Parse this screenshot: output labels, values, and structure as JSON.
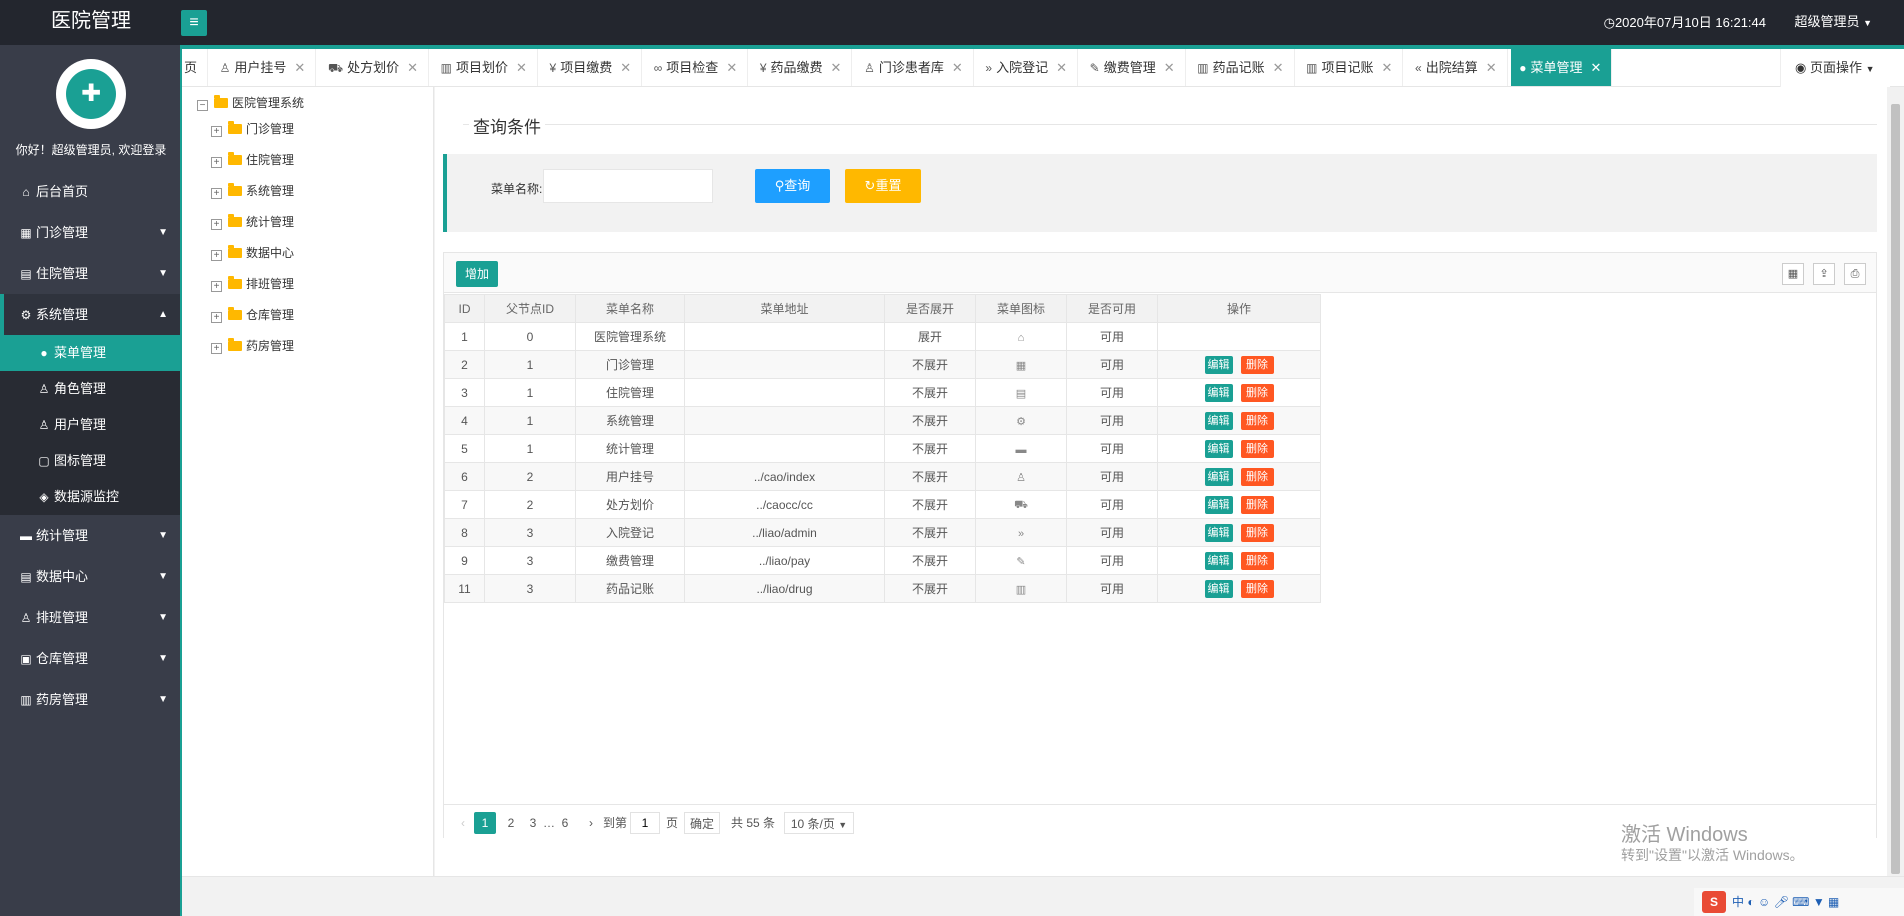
{
  "header": {
    "app_title": "医院管理",
    "menu_icon": "hamburger-icon",
    "datetime": "2020年07月10日 16:21:44",
    "user": "超级管理员"
  },
  "sidebar": {
    "welcome": "你好！超级管理员, 欢迎登录",
    "items": [
      {
        "label": "后台首页",
        "icon": "home-icon"
      },
      {
        "label": "门诊管理",
        "icon": "grid-plus-icon"
      },
      {
        "label": "住院管理",
        "icon": "building-icon"
      },
      {
        "label": "系统管理",
        "icon": "gear-icon"
      },
      {
        "label": "统计管理",
        "icon": "chat-icon"
      },
      {
        "label": "数据中心",
        "icon": "document-icon"
      },
      {
        "label": "排班管理",
        "icon": "users-icon"
      },
      {
        "label": "仓库管理",
        "icon": "boxes-icon"
      },
      {
        "label": "药房管理",
        "icon": "book-icon"
      }
    ],
    "sub_items": [
      {
        "label": "菜单管理",
        "icon": "circle-icon"
      },
      {
        "label": "角色管理",
        "icon": "user-icon"
      },
      {
        "label": "用户管理",
        "icon": "users-icon"
      },
      {
        "label": "图标管理",
        "icon": "note-icon"
      },
      {
        "label": "数据源监控",
        "icon": "cube-icon"
      }
    ]
  },
  "tabs": [
    {
      "label": "页",
      "icon": ""
    },
    {
      "label": "用户挂号",
      "icon": "user-icon"
    },
    {
      "label": "处方划价",
      "icon": "cart-icon"
    },
    {
      "label": "项目划价",
      "icon": "chart-icon"
    },
    {
      "label": "项目缴费",
      "icon": "yen-icon"
    },
    {
      "label": "项目检查",
      "icon": "link-icon"
    },
    {
      "label": "药品缴费",
      "icon": "yen-icon"
    },
    {
      "label": "门诊患者库",
      "icon": "user-icon"
    },
    {
      "label": "入院登记",
      "icon": "double-right-icon"
    },
    {
      "label": "缴费管理",
      "icon": "edit-icon"
    },
    {
      "label": "药品记账",
      "icon": "book-icon"
    },
    {
      "label": "项目记账",
      "icon": "book-icon"
    },
    {
      "label": "出院结算",
      "icon": "double-left-icon"
    },
    {
      "label": "菜单管理",
      "icon": "circle-icon"
    }
  ],
  "page_ops_label": "页面操作",
  "tree": {
    "root": "医院管理系统",
    "children": [
      "门诊管理",
      "住院管理",
      "系统管理",
      "统计管理",
      "数据中心",
      "排班管理",
      "仓库管理",
      "药房管理"
    ]
  },
  "query": {
    "title": "查询条件",
    "name_label": "菜单名称:",
    "name_value": "",
    "search_label": "查询",
    "reset_label": "重置"
  },
  "toolbar": {
    "add_label": "增加"
  },
  "table": {
    "headers": [
      "ID",
      "父节点ID",
      "菜单名称",
      "菜单地址",
      "是否展开",
      "菜单图标",
      "是否可用",
      "操作"
    ],
    "edit_label": "编辑",
    "delete_label": "删除",
    "rows": [
      {
        "id": "1",
        "pid": "0",
        "name": "医院管理系统",
        "url": "",
        "open": "展开",
        "icon": "home-icon",
        "enabled": "可用",
        "ops": false
      },
      {
        "id": "2",
        "pid": "1",
        "name": "门诊管理",
        "url": "",
        "open": "不展开",
        "icon": "grid-plus-icon",
        "enabled": "可用",
        "ops": true
      },
      {
        "id": "3",
        "pid": "1",
        "name": "住院管理",
        "url": "",
        "open": "不展开",
        "icon": "building-icon",
        "enabled": "可用",
        "ops": true
      },
      {
        "id": "4",
        "pid": "1",
        "name": "系统管理",
        "url": "",
        "open": "不展开",
        "icon": "gear-icon",
        "enabled": "可用",
        "ops": true
      },
      {
        "id": "5",
        "pid": "1",
        "name": "统计管理",
        "url": "",
        "open": "不展开",
        "icon": "chat-icon",
        "enabled": "可用",
        "ops": true
      },
      {
        "id": "6",
        "pid": "2",
        "name": "用户挂号",
        "url": "../cao/index",
        "open": "不展开",
        "icon": "user-icon",
        "enabled": "可用",
        "ops": true
      },
      {
        "id": "7",
        "pid": "2",
        "name": "处方划价",
        "url": "../caocc/cc",
        "open": "不展开",
        "icon": "cart-icon",
        "enabled": "可用",
        "ops": true
      },
      {
        "id": "8",
        "pid": "3",
        "name": "入院登记",
        "url": "../liao/admin",
        "open": "不展开",
        "icon": "double-right-icon",
        "enabled": "可用",
        "ops": true
      },
      {
        "id": "9",
        "pid": "3",
        "name": "缴费管理",
        "url": "../liao/pay",
        "open": "不展开",
        "icon": "edit-icon",
        "enabled": "可用",
        "ops": true
      },
      {
        "id": "11",
        "pid": "3",
        "name": "药品记账",
        "url": "../liao/drug",
        "open": "不展开",
        "icon": "book-icon",
        "enabled": "可用",
        "ops": true
      }
    ]
  },
  "pager": {
    "pages": [
      "1",
      "2",
      "3",
      "…",
      "6"
    ],
    "current": "1",
    "goto_label": "到第",
    "goto_value": "1",
    "page_unit": "页",
    "confirm_label": "确定",
    "total": "共 55 条",
    "page_size": "10 条/页"
  },
  "watermark": {
    "line1": "激活 Windows",
    "line2": "转到\"设置\"以激活 Windows。"
  },
  "tray": {
    "ime": "中"
  },
  "colors": {
    "accent": "#1aa094",
    "query_blue": "#1e9fff",
    "reset_yellow": "#ffb800",
    "delete_red": "#ff5722",
    "sidebar_bg": "#393d49"
  }
}
